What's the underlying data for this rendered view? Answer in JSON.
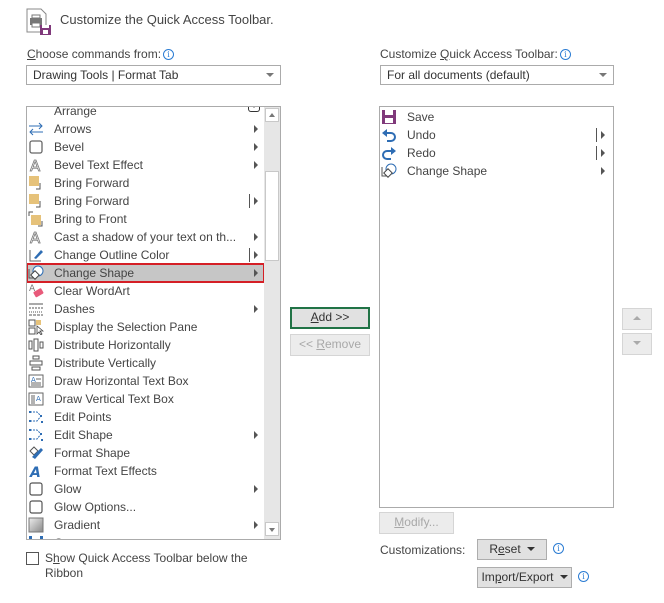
{
  "header": {
    "title": "Customize the Quick Access Toolbar.",
    "icon": "customize-qat-icon"
  },
  "left": {
    "label": "Choose commands from:",
    "label_accesskey": "C",
    "info_icon": "info-icon",
    "dropdown_value": "Drawing Tools | Format Tab",
    "commands": [
      {
        "label": "Arrange",
        "icon": "arrange-icon",
        "submenu": "dropdown-glyph"
      },
      {
        "label": "Arrows",
        "icon": "arrows-icon",
        "submenu": "arrow"
      },
      {
        "label": "Bevel",
        "icon": "bevel-icon",
        "submenu": "arrow"
      },
      {
        "label": "Bevel Text Effect",
        "icon": "bevel-text-icon",
        "submenu": "arrow"
      },
      {
        "label": "Bring Forward",
        "icon": "bring-forward-icon",
        "submenu": ""
      },
      {
        "label": "Bring Forward",
        "icon": "bring-forward-icon",
        "submenu": "split"
      },
      {
        "label": "Bring to Front",
        "icon": "bring-to-front-icon",
        "submenu": ""
      },
      {
        "label": "Cast a shadow of your text on th...",
        "icon": "text-shadow-icon",
        "submenu": "arrow"
      },
      {
        "label": "Change Outline Color",
        "icon": "outline-color-icon",
        "submenu": "split"
      },
      {
        "label": "Change Shape",
        "icon": "change-shape-icon",
        "submenu": "arrow",
        "selected": true
      },
      {
        "label": "Clear WordArt",
        "icon": "eraser-icon",
        "submenu": ""
      },
      {
        "label": "Dashes",
        "icon": "dashes-icon",
        "submenu": "arrow"
      },
      {
        "label": "Display the Selection Pane",
        "icon": "selection-pane-icon",
        "submenu": ""
      },
      {
        "label": "Distribute Horizontally",
        "icon": "distribute-horizontal-icon",
        "submenu": ""
      },
      {
        "label": "Distribute Vertically",
        "icon": "distribute-vertical-icon",
        "submenu": ""
      },
      {
        "label": "Draw Horizontal Text Box",
        "icon": "horizontal-text-box-icon",
        "submenu": ""
      },
      {
        "label": "Draw Vertical Text Box",
        "icon": "vertical-text-box-icon",
        "submenu": ""
      },
      {
        "label": "Edit Points",
        "icon": "edit-points-icon",
        "submenu": ""
      },
      {
        "label": "Edit Shape",
        "icon": "edit-shape-icon",
        "submenu": "arrow"
      },
      {
        "label": "Format Shape",
        "icon": "format-shape-icon",
        "submenu": ""
      },
      {
        "label": "Format Text Effects",
        "icon": "format-text-effects-icon",
        "submenu": ""
      },
      {
        "label": "Glow",
        "icon": "glow-icon",
        "submenu": "arrow"
      },
      {
        "label": "Glow Options...",
        "icon": "glow-options-icon",
        "submenu": ""
      },
      {
        "label": "Gradient",
        "icon": "gradient-icon",
        "submenu": "arrow"
      },
      {
        "label": "Gr...",
        "icon": "group-icon",
        "submenu": ""
      }
    ],
    "show_below_ribbon_label": "Show Quick Access Toolbar below the Ribbon",
    "show_below_ribbon_checked": false
  },
  "middle": {
    "add_label": "Add >>",
    "remove_label": "<< Remove"
  },
  "right": {
    "label": "Customize Quick Access Toolbar:",
    "dropdown_value": "For all documents (default)",
    "items": [
      {
        "label": "Save",
        "icon": "save-icon",
        "submenu": ""
      },
      {
        "label": "Undo",
        "icon": "undo-icon",
        "submenu": "split"
      },
      {
        "label": "Redo",
        "icon": "redo-icon",
        "submenu": "split"
      },
      {
        "label": "Change Shape",
        "icon": "change-shape-icon",
        "submenu": "arrow"
      }
    ],
    "modify_label": "Modify...",
    "customizations_label": "Customizations:",
    "reset_label": "Reset",
    "import_export_label": "Import/Export",
    "move_up_icon": "move-up-icon",
    "move_down_icon": "move-down-icon"
  },
  "colors": {
    "selection_outline": "#d51f26",
    "selection_bg": "#c6c6c6",
    "default_button_border": "#217346",
    "info_blue": "#2b7cd3",
    "save_purple": "#80397b",
    "undo_blue": "#2e6db4"
  }
}
